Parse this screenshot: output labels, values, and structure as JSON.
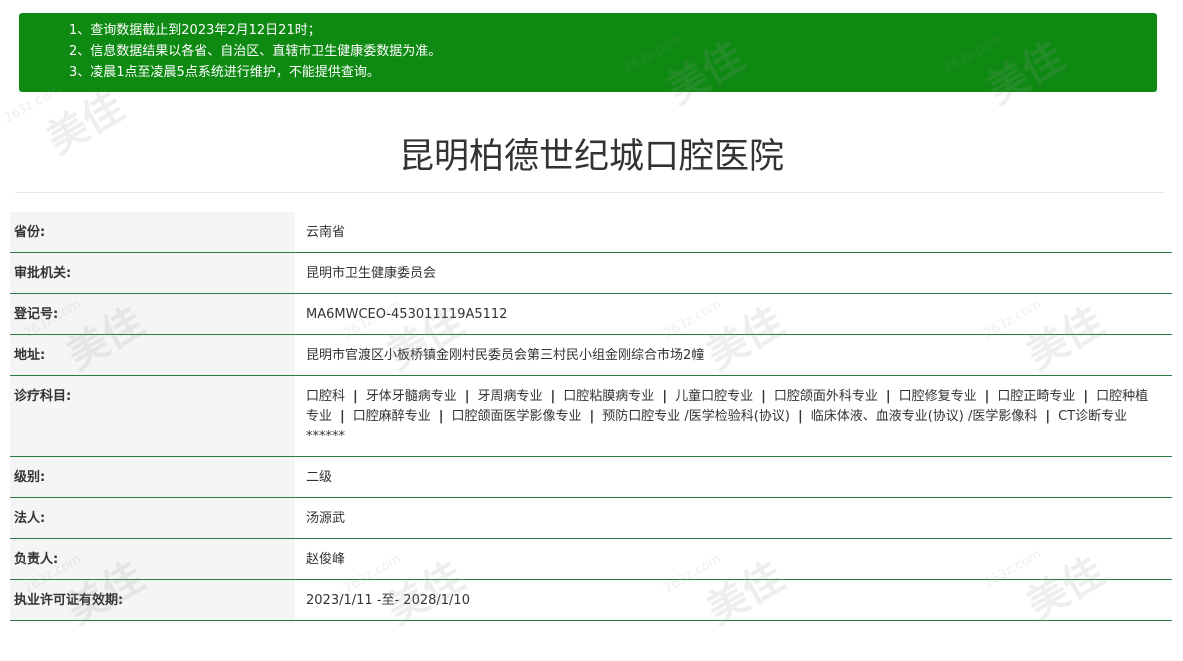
{
  "notice": {
    "lines": [
      "1、查询数据截止到2023年2月12日21时；",
      "2、信息数据结果以各省、自治区、直辖市卫生健康委数据为准。",
      "3、凌晨1点至凌晨5点系统进行维护，不能提供查询。"
    ],
    "background_color": "#0e8a13"
  },
  "title": "昆明柏德世纪城口腔医院",
  "details": [
    {
      "label": "省份:",
      "value": "云南省"
    },
    {
      "label": "审批机关:",
      "value": "昆明市卫生健康委员会"
    },
    {
      "label": "登记号:",
      "value": "MA6MWCEO-453011119A5112"
    },
    {
      "label": "地址:",
      "value": "昆明市官渡区小板桥镇金刚村民委员会第三村民小组金刚综合市场2幢"
    },
    {
      "label": "诊疗科目:",
      "separator": "|",
      "items": [
        "口腔科",
        "牙体牙髓病专业",
        "牙周病专业",
        "口腔粘膜病专业",
        "儿童口腔专业",
        "口腔颌面外科专业",
        "口腔修复专业",
        "口腔正畸专业",
        "口腔种植专业",
        "口腔麻醉专业",
        "口腔颌面医学影像专业",
        "预防口腔专业 /医学检验科(协议)",
        "临床体液、血液专业(协议) /医学影像科",
        "CT诊断专业******"
      ]
    },
    {
      "label": "级别:",
      "value": "二级"
    },
    {
      "label": "法人:",
      "value": "汤源武"
    },
    {
      "label": "负责人:",
      "value": "赵俊峰"
    },
    {
      "label": "执业许可证有效期:",
      "value": "2023/1/11 -至- 2028/1/10"
    }
  ],
  "colors": {
    "row_border": "#2c7a47",
    "label_background": "#f5f5f5"
  },
  "watermark": {
    "site": "263z.com",
    "brand": "美佳"
  }
}
